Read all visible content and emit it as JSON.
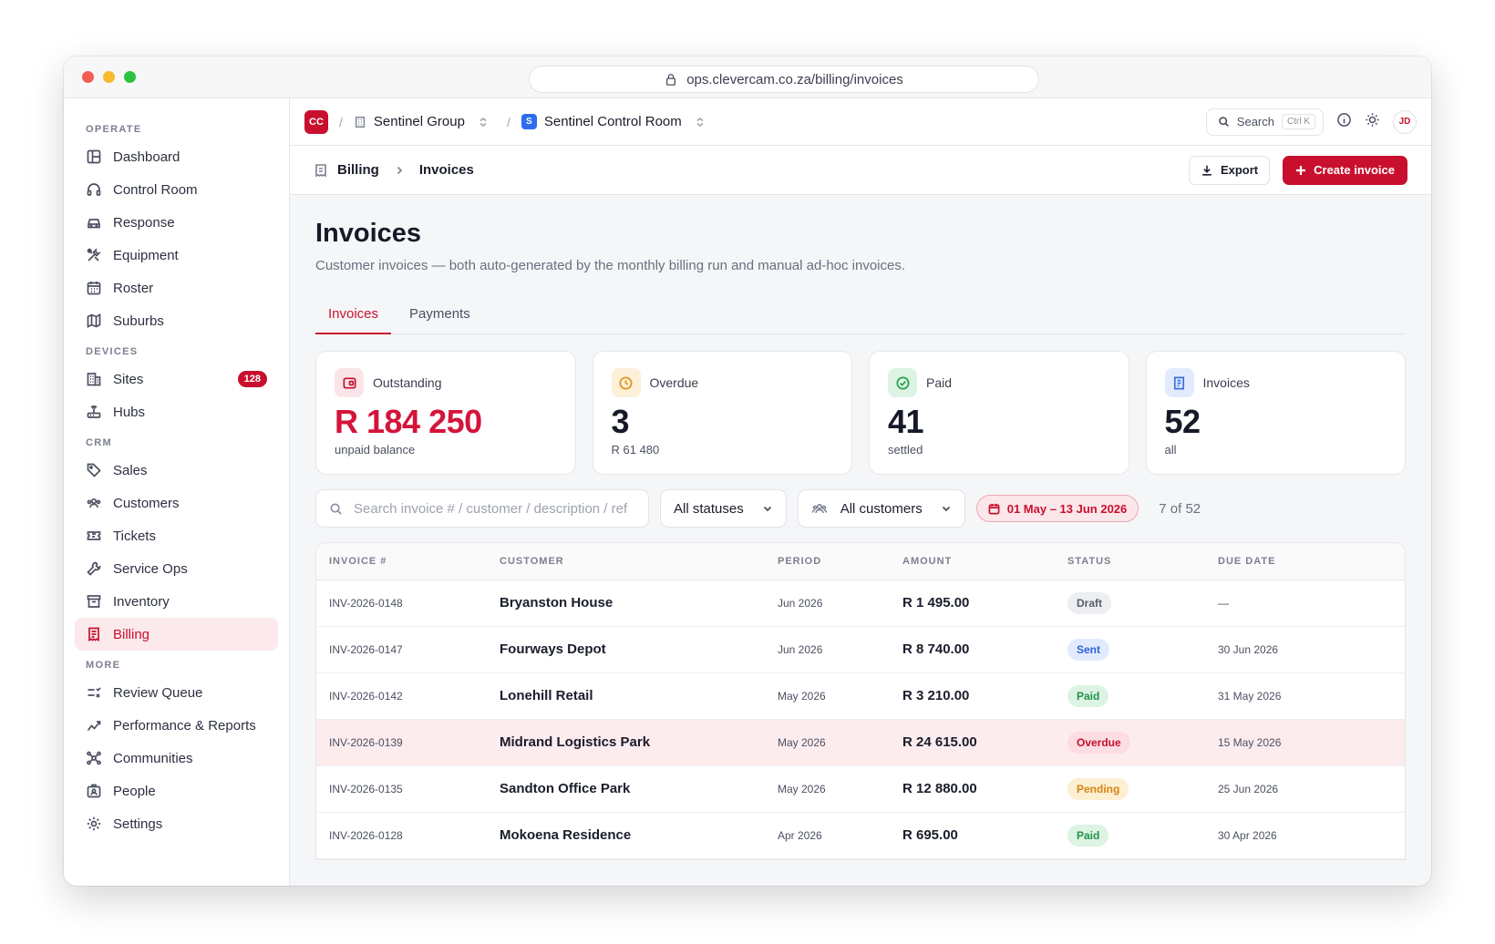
{
  "browser": {
    "url": "ops.clevercam.co.za/billing/invoices"
  },
  "sidebar": {
    "sections": [
      {
        "label": "OPERATE",
        "items": [
          {
            "label": "Dashboard",
            "icon": "layout-icon"
          },
          {
            "label": "Control Room",
            "icon": "headset-icon"
          },
          {
            "label": "Response",
            "icon": "car-icon"
          },
          {
            "label": "Equipment",
            "icon": "tools-icon"
          },
          {
            "label": "Roster",
            "icon": "calendar-icon"
          },
          {
            "label": "Suburbs",
            "icon": "map-icon"
          }
        ]
      },
      {
        "label": "DEVICES",
        "items": [
          {
            "label": "Sites",
            "icon": "building-icon",
            "badge": "128"
          },
          {
            "label": "Hubs",
            "icon": "router-icon"
          }
        ]
      },
      {
        "label": "CRM",
        "items": [
          {
            "label": "Sales",
            "icon": "tag-icon"
          },
          {
            "label": "Customers",
            "icon": "users-icon"
          },
          {
            "label": "Tickets",
            "icon": "ticket-icon"
          },
          {
            "label": "Service Ops",
            "icon": "wrench-icon"
          },
          {
            "label": "Inventory",
            "icon": "archive-icon"
          },
          {
            "label": "Billing",
            "icon": "receipt-icon",
            "active": true
          }
        ]
      },
      {
        "label": "MORE",
        "items": [
          {
            "label": "Review Queue",
            "icon": "list-check-icon"
          },
          {
            "label": "Performance & Reports",
            "icon": "trend-icon"
          },
          {
            "label": "Communities",
            "icon": "network-icon"
          },
          {
            "label": "People",
            "icon": "id-card-icon"
          },
          {
            "label": "Settings",
            "icon": "gear-icon"
          }
        ]
      }
    ]
  },
  "topbar": {
    "org_badge": "CC",
    "separator": "/",
    "group": "Sentinel Group",
    "room_badge": "S",
    "room": "Sentinel Control Room",
    "search_label": "Search",
    "search_kbd": "Ctrl K",
    "avatar": "JD"
  },
  "pagebar": {
    "section": "Billing",
    "page": "Invoices",
    "export_label": "Export",
    "create_label": "Create invoice"
  },
  "header": {
    "title": "Invoices",
    "subtitle": "Customer invoices — both auto-generated by the monthly billing run and manual ad-hoc invoices."
  },
  "tabs": [
    {
      "label": "Invoices",
      "active": true
    },
    {
      "label": "Payments",
      "active": false
    }
  ],
  "stats": [
    {
      "label": "Outstanding",
      "value": "R 184 250",
      "note": "unpaid balance",
      "tone": "red",
      "icon": "wallet-icon"
    },
    {
      "label": "Overdue",
      "value": "3",
      "note": "R 61 480",
      "tone": "amber",
      "icon": "clock-icon"
    },
    {
      "label": "Paid",
      "value": "41",
      "note": "settled",
      "tone": "green",
      "icon": "check-circle-icon"
    },
    {
      "label": "Invoices",
      "value": "52",
      "note": "all",
      "tone": "blue",
      "icon": "document-icon"
    }
  ],
  "filters": {
    "search_placeholder": "Search invoice # / customer / description / ref",
    "status": "All statuses",
    "customers": "All customers",
    "date_range": "01 May – 13 Jun 2026",
    "count": "7 of 52"
  },
  "table": {
    "columns": [
      "INVOICE #",
      "CUSTOMER",
      "PERIOD",
      "AMOUNT",
      "STATUS",
      "DUE DATE"
    ],
    "rows": [
      {
        "invoice": "INV-2026-0148",
        "customer": "Bryanston House",
        "period": "Jun 2026",
        "amount": "R 1 495.00",
        "status": "Draft",
        "due": "—"
      },
      {
        "invoice": "INV-2026-0147",
        "customer": "Fourways Depot",
        "period": "Jun 2026",
        "amount": "R 8 740.00",
        "status": "Sent",
        "due": "30 Jun 2026"
      },
      {
        "invoice": "INV-2026-0142",
        "customer": "Lonehill Retail",
        "period": "May 2026",
        "amount": "R 3 210.00",
        "status": "Paid",
        "due": "31 May 2026"
      },
      {
        "invoice": "INV-2026-0139",
        "customer": "Midrand Logistics Park",
        "period": "May 2026",
        "amount": "R 24 615.00",
        "status": "Overdue",
        "due": "15 May 2026",
        "highlight": true
      },
      {
        "invoice": "INV-2026-0135",
        "customer": "Sandton Office Park",
        "period": "May 2026",
        "amount": "R 12 880.00",
        "status": "Pending",
        "due": "25 Jun 2026"
      },
      {
        "invoice": "INV-2026-0128",
        "customer": "Mokoena Residence",
        "period": "Apr 2026",
        "amount": "R 695.00",
        "status": "Paid",
        "due": "30 Apr 2026"
      }
    ]
  },
  "colors": {
    "accent": "#c8102e",
    "blue": "#2f6df0"
  }
}
